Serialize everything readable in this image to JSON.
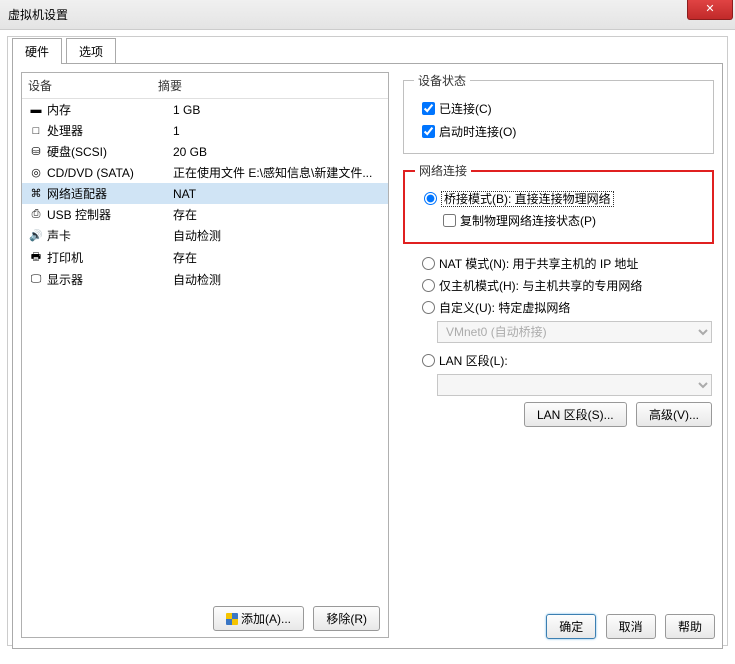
{
  "window": {
    "title": "虚拟机设置"
  },
  "tabs": {
    "hardware": "硬件",
    "options": "选项"
  },
  "left": {
    "hdr_device": "设备",
    "hdr_summary": "摘要",
    "devices": [
      {
        "icon": "▬",
        "name": "内存",
        "summary": "1 GB"
      },
      {
        "icon": "□",
        "name": "处理器",
        "summary": "1"
      },
      {
        "icon": "⛁",
        "name": "硬盘(SCSI)",
        "summary": "20 GB"
      },
      {
        "icon": "◎",
        "name": "CD/DVD (SATA)",
        "summary": "正在使用文件 E:\\感知信息\\新建文件..."
      },
      {
        "icon": "⌘",
        "name": "网络适配器",
        "summary": "NAT"
      },
      {
        "icon": "⎙",
        "name": "USB 控制器",
        "summary": "存在"
      },
      {
        "icon": "🔊",
        "name": "声卡",
        "summary": "自动检测"
      },
      {
        "icon": "🖶",
        "name": "打印机",
        "summary": "存在"
      },
      {
        "icon": "🖵",
        "name": "显示器",
        "summary": "自动检测"
      }
    ],
    "add_btn": "添加(A)...",
    "remove_btn": "移除(R)"
  },
  "right": {
    "status_legend": "设备状态",
    "connected": "已连接(C)",
    "connect_at_poweron": "启动时连接(O)",
    "netconn_legend": "网络连接",
    "bridged": "桥接模式(B): 直接连接物理网络",
    "replicate": "复制物理网络连接状态(P)",
    "nat": "NAT 模式(N): 用于共享主机的 IP 地址",
    "hostonly": "仅主机模式(H): 与主机共享的专用网络",
    "custom": "自定义(U): 特定虚拟网络",
    "custom_combo": "VMnet0 (自动桥接)",
    "lanseg": "LAN 区段(L):",
    "lanseg_btn": "LAN 区段(S)...",
    "adv_btn": "高级(V)..."
  },
  "footer": {
    "ok": "确定",
    "cancel": "取消",
    "help": "帮助"
  }
}
